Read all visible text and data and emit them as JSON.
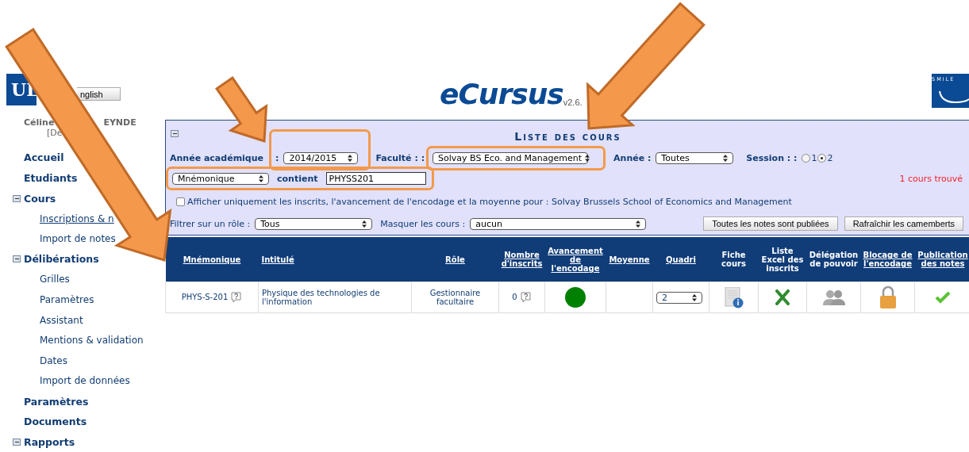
{
  "header": {
    "logo": "UL",
    "language_button": "nglish",
    "app_title": "eCursus",
    "version": "v2.6.",
    "partner_logo": "SMILE"
  },
  "user": {
    "first_name": "Céline",
    "name_fragment": "EYNDE",
    "role_fragment": "[Dé"
  },
  "sidebar": {
    "items": [
      {
        "kind": "link",
        "label": "Accueil"
      },
      {
        "kind": "link",
        "label": "Etudiants"
      },
      {
        "kind": "group",
        "label": "Cours",
        "expanded": true,
        "children": [
          {
            "label": "Inscriptions & n",
            "selected": true
          },
          {
            "label": "Import de notes",
            "selected": false
          }
        ]
      },
      {
        "kind": "group",
        "label": "Délibérations",
        "expanded": true,
        "children": [
          {
            "label": "Grilles",
            "selected": false
          },
          {
            "label": "Paramètres",
            "selected": false
          },
          {
            "label": "Assistant",
            "selected": false
          },
          {
            "label": "Mentions & validation",
            "selected": false
          },
          {
            "label": "Dates",
            "selected": false
          },
          {
            "label": "Import de données",
            "selected": false
          }
        ]
      },
      {
        "kind": "link",
        "label": "Paramètres"
      },
      {
        "kind": "link",
        "label": "Documents"
      },
      {
        "kind": "group",
        "label": "Rapports",
        "expanded": true
      }
    ]
  },
  "panel": {
    "title": "Liste des cours",
    "academic_year": {
      "label": "Année académique",
      "separator": ":",
      "value": "2014/2015"
    },
    "faculty": {
      "label": "Faculté : :",
      "value": "Solvay BS Eco. and Management"
    },
    "year": {
      "label": "Année :",
      "value": "Toutes"
    },
    "session": {
      "label": "Session : :",
      "options": [
        {
          "label": "1",
          "selected": false
        },
        {
          "label": "2",
          "selected": true
        }
      ]
    },
    "search_field": {
      "value": "Mnémonique"
    },
    "contains": {
      "label": "contient",
      "value": "PHYSS201"
    },
    "result_count": "1 cours trouvé",
    "only_enrolled": {
      "checked": false,
      "label": "Afficher uniquement les inscrits, l'avancement de l'encodage et la moyenne pour : Solvay Brussels School of Economics and Management"
    },
    "role_filter": {
      "label": "Filtrer sur un rôle :",
      "value": "Tous"
    },
    "hide_courses": {
      "label": "Masquer les cours :",
      "value": "aucun"
    },
    "buttons": [
      "Toutes les notes sont publiées",
      "Rafraîchir les camemberts"
    ]
  },
  "table": {
    "columns": [
      {
        "label": "Mnémonique",
        "sortable": true
      },
      {
        "label": "Intitulé",
        "sortable": true
      },
      {
        "label": "Rôle",
        "sortable": true
      },
      {
        "label": "Nombre d'inscrits",
        "sortable": true
      },
      {
        "label": "Avancement de l'encodage",
        "sortable": true
      },
      {
        "label": "Moyenne",
        "sortable": true
      },
      {
        "label": "Quadri",
        "sortable": true
      },
      {
        "label": "Fiche cours",
        "sortable": false
      },
      {
        "label": "Liste Excel des inscrits",
        "sortable": false
      },
      {
        "label": "Délégation de pouvoir",
        "sortable": false
      },
      {
        "label": "Blocage de l'encodage",
        "sortable": true
      },
      {
        "label": "Publication des notes",
        "sortable": true
      }
    ],
    "rows": [
      {
        "mnemonic": "PHYS-S-201",
        "title": "Physique des technologies de l'information",
        "role": "Gestionnaire facultaire",
        "enrolled": "0",
        "color": "#008000",
        "quadri": "2"
      }
    ]
  }
}
